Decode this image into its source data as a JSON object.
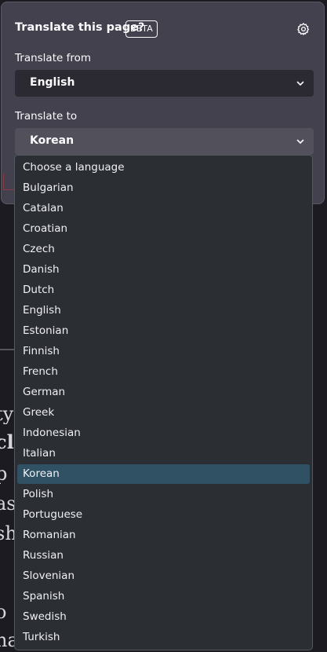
{
  "panel": {
    "title": "Translate this page?",
    "badge": "BETA",
    "settings_icon": "gear-icon",
    "from_label": "Translate from",
    "from_value": "English",
    "to_label": "Translate to",
    "to_value": "Korean",
    "chevron_icon": "chevron-down-icon"
  },
  "dropdown": {
    "selected": "Korean",
    "options": [
      "Choose a language",
      "Bulgarian",
      "Catalan",
      "Croatian",
      "Czech",
      "Danish",
      "Dutch",
      "English",
      "Estonian",
      "Finnish",
      "French",
      "German",
      "Greek",
      "Indonesian",
      "Italian",
      "Korean",
      "Polish",
      "Portuguese",
      "Romanian",
      "Russian",
      "Slovenian",
      "Spanish",
      "Swedish",
      "Turkish"
    ]
  },
  "background_fragments": [
    "ty",
    "cl",
    "p",
    "as",
    "sh",
    "o",
    "na"
  ],
  "colors": {
    "panel_bg": "#42414d",
    "select_bg": "#2b2a33",
    "dropdown_bg": "#2b2e33",
    "highlight": "#2f5163",
    "text": "#fbfbfe"
  }
}
